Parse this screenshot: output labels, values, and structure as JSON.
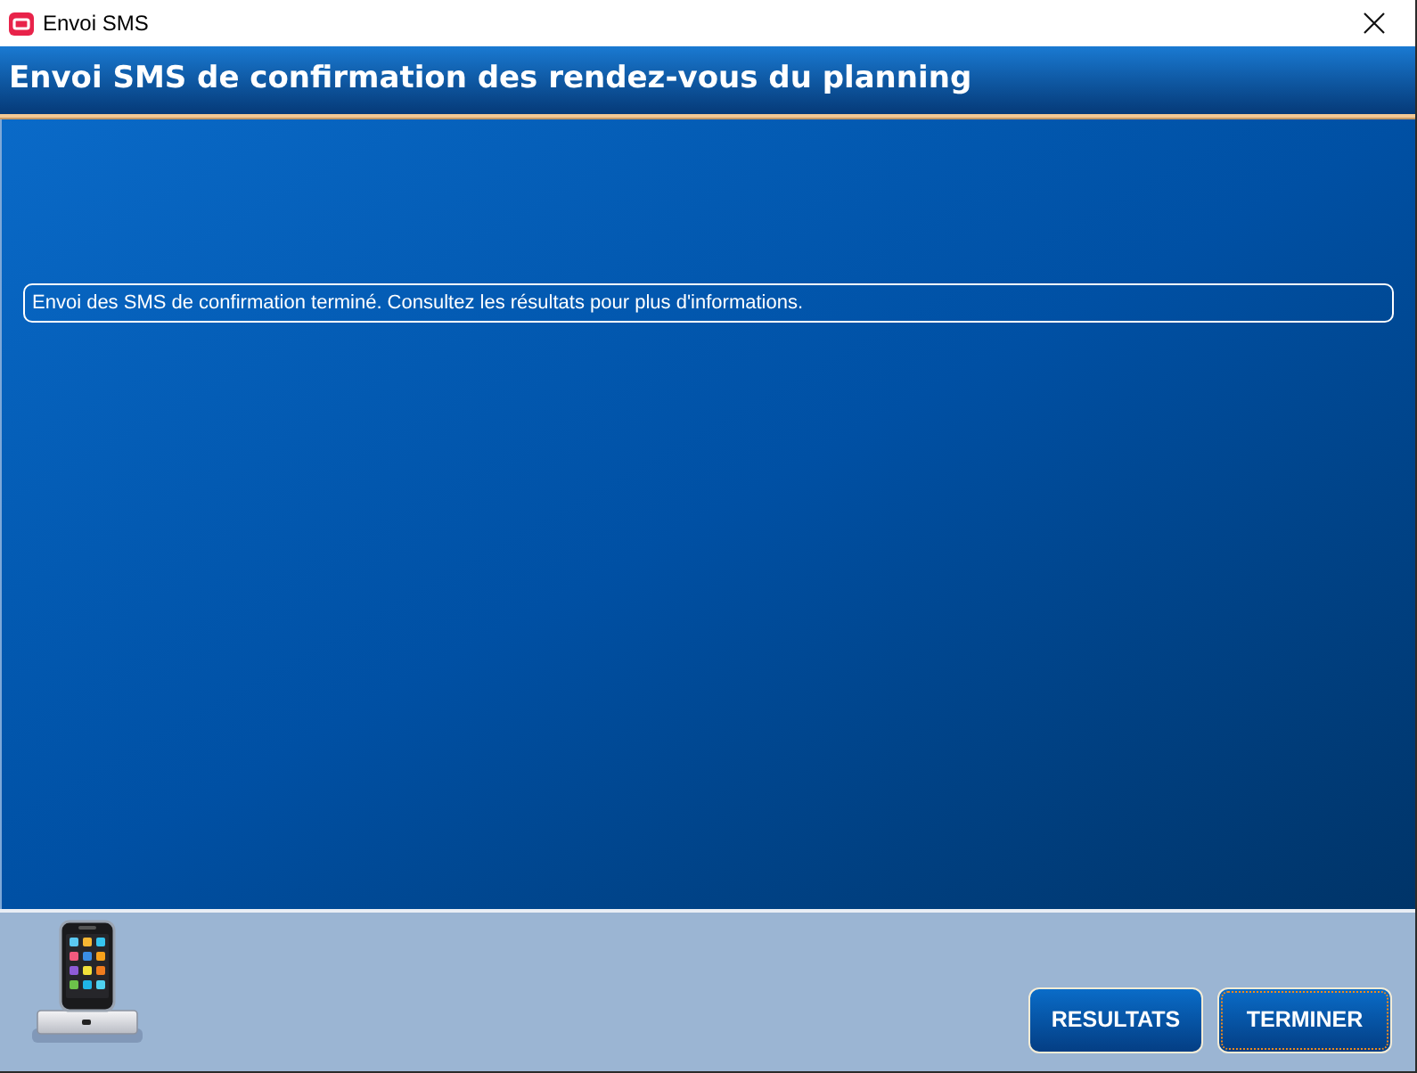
{
  "window": {
    "title": "Envoi SMS"
  },
  "header": {
    "title": "Envoi SMS de confirmation des rendez-vous du planning"
  },
  "message": "Envoi des SMS de confirmation terminé. Consultez les résultats pour plus d'informations.",
  "buttons": [
    {
      "label": "RESULTATS",
      "focused": false
    },
    {
      "label": "TERMINER",
      "focused": true
    }
  ]
}
